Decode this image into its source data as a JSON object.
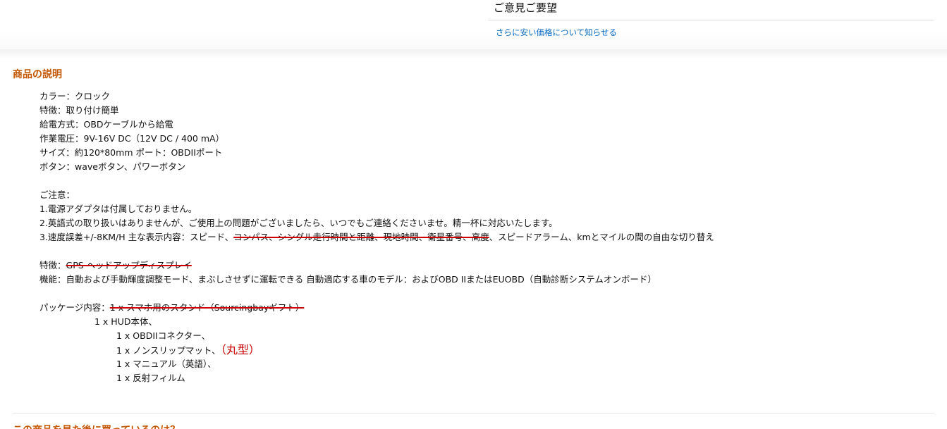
{
  "feedback": {
    "heading": "ご意見ご要望",
    "price_link": "さらに安い価格について知らせる"
  },
  "description": {
    "title": "商品の説明",
    "lines": {
      "color": "カラー：クロック",
      "feature": "特徴：取り付け簡単",
      "power": "給電方式：OBDケーブルから給電",
      "voltage": "作業電圧：9V-16V DC（12V DC / 400 mA）",
      "size": "サイズ：約120*80mm ポート：OBDIIポート",
      "buttons": "ボタン：waveボタン、パワーボタン",
      "notice_label": "ご注意：",
      "note1": "1.電源アダプタは付属しておりません。",
      "note2": "2.英語式の取り扱いはありませんが、ご使用上の問題がございましたら、いつでもご連絡くださいませ。精一杯に対応いたします。",
      "note3_prefix": "3.速度誤差+/-8KM/H 主な表示内容：スピード、",
      "note3_struck": "コンパス、シングル走行時間と距離、現地時間、衛星番号、高度",
      "note3_suffix": "、スピードアラーム、kmとマイルの間の自由な切り替え",
      "feature2_prefix": "特徴：",
      "feature2_struck": "GPS ヘッドアップディスプレイ",
      "function": "機能：自動および手動輝度調整モード、まぶしさせずに運転できる 自動適応する車のモデル：およびOBD IIまたはEUOBD（自動診断システムオンボード）",
      "package_prefix": "パッケージ内容：",
      "package_struck": "1 x スマホ用のスタンド（Sourcingbayギフト）",
      "item_hud": "1 x HUD本体、",
      "item_obd": "1 x OBDIIコネクター、",
      "item_mat": "1 x ノンスリップマット、",
      "item_mat_note": "（丸型）",
      "item_manual": "1 x マニュアル（英語）、",
      "item_film": "1 x 反射フィルム"
    }
  },
  "next_section": {
    "title": "この商品を見た後に買っているのは？"
  },
  "colors": {
    "section_title": "#c45500",
    "link": "#0066c0",
    "annotation_red": "#cc0000"
  }
}
